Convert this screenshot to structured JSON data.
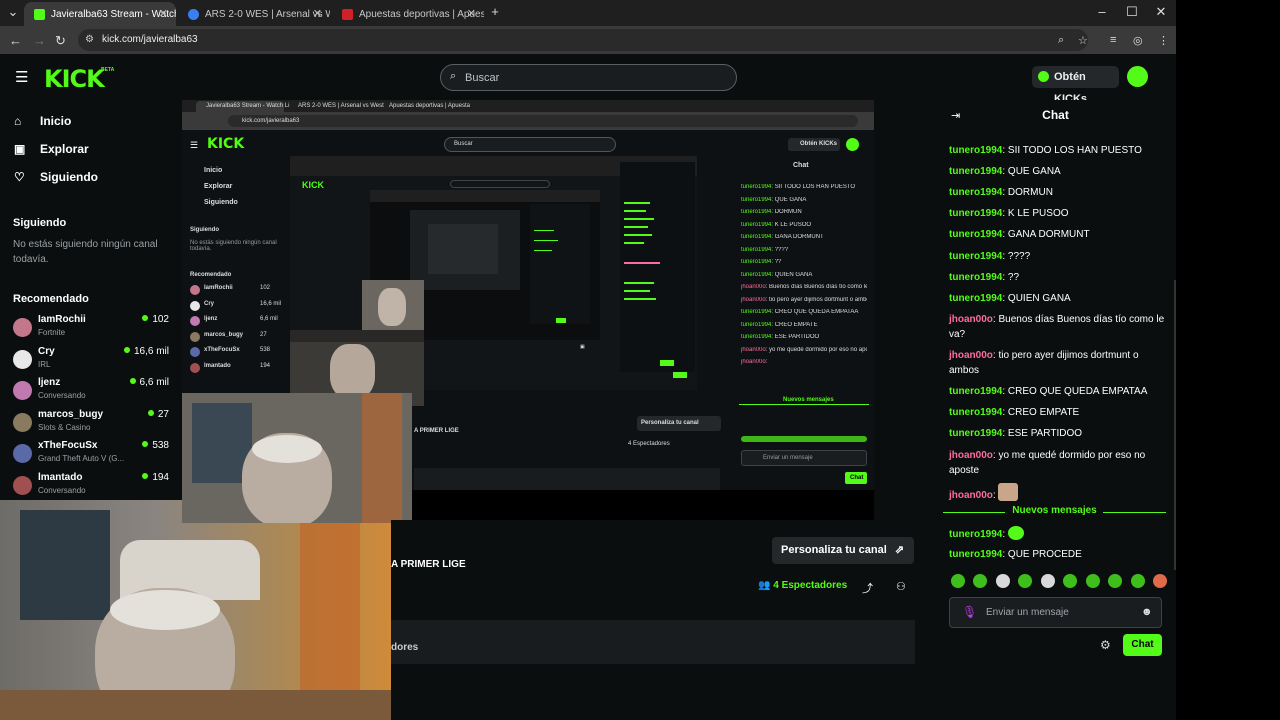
{
  "browser": {
    "tabs": [
      {
        "title": "Javieralba63 Stream - Watch Li",
        "active": true
      },
      {
        "title": "ARS 2-0 WES | Arsenal vs West",
        "active": false
      },
      {
        "title": "Apuestas deportivas | Apuesta",
        "active": false
      }
    ],
    "url": "kick.com/javieralba63"
  },
  "header": {
    "logo": "KICK",
    "beta": "BETA",
    "search_placeholder": "Buscar",
    "kicks_button": "Obtén KICKs"
  },
  "sidebar": {
    "nav": [
      {
        "label": "Inicio",
        "icon": "home-icon"
      },
      {
        "label": "Explorar",
        "icon": "compass-icon"
      },
      {
        "label": "Siguiendo",
        "icon": "heart-icon"
      }
    ],
    "following_title": "Siguiendo",
    "following_empty": "No estás siguiendo ningún canal todavía.",
    "recommended_title": "Recomendado",
    "recommended": [
      {
        "name": "IamRochii",
        "category": "Fortnite",
        "viewers": "102",
        "color": "#c2788a"
      },
      {
        "name": "Cry",
        "category": "IRL",
        "viewers": "16,6 mil",
        "color": "#e8e8e8"
      },
      {
        "name": "ljenz",
        "category": "Conversando",
        "viewers": "6,6 mil",
        "color": "#c07ab0"
      },
      {
        "name": "marcos_bugy",
        "category": "Slots & Casino",
        "viewers": "27",
        "color": "#8a7a60"
      },
      {
        "name": "xTheFocuSx",
        "category": "Grand Theft Auto V (G...",
        "viewers": "538",
        "color": "#5a6aa8"
      },
      {
        "name": "lmantado",
        "category": "Conversando",
        "viewers": "194",
        "color": "#a05050"
      }
    ]
  },
  "stream": {
    "nested_tabs": [
      "Javieralba63 Stream - Watch Li",
      "ARS 2-0 WES | Arsenal vs West",
      "Apuestas deportivas | Apuesta"
    ],
    "nested_url": "kick.com/javieralba63",
    "nested_search": "Buscar",
    "nested_kicks": "Obtén KICKs",
    "nested_nav": [
      "Inicio",
      "Explorar",
      "Siguiendo"
    ],
    "nested_following": "Siguiendo",
    "nested_following_empty": "No estás siguiendo ningún canal todavía.",
    "nested_recommended": "Recomendado",
    "nested_rec_names": [
      "IamRochii",
      "Cry",
      "ljenz",
      "marcos_bugy",
      "xTheFocuSx",
      "lmantado"
    ],
    "nested_rec_views": [
      "102",
      "16,6 mil",
      "6,6 mil",
      "27",
      "538",
      "194"
    ],
    "nested_chat_title": "Chat",
    "nested_personaliza": "Personaliza tu canal",
    "nested_primer": "A PRIMER LIGE",
    "nested_espect": "4 Espectadores",
    "nested_input": "Enviar un mensaje",
    "nested_chat_btn": "Chat",
    "nested_new": "Nuevos mensajes"
  },
  "channel": {
    "personaliza": "Personaliza tu canal",
    "title_fragment": "A PRIMER LIGE",
    "viewers_count": "4",
    "viewers_label": "Espectadores",
    "info_fragment": "dores"
  },
  "chat": {
    "title": "Chat",
    "messages": [
      {
        "user": "tunero1994",
        "text": "SII TODO LOS HAN PUESTO",
        "type": 1
      },
      {
        "user": "tunero1994",
        "text": "QUE GANA",
        "type": 1
      },
      {
        "user": "tunero1994",
        "text": "DORMUN",
        "type": 1
      },
      {
        "user": "tunero1994",
        "text": "K LE PUSOO",
        "type": 1
      },
      {
        "user": "tunero1994",
        "text": "GANA DORMUNT",
        "type": 1
      },
      {
        "user": "tunero1994",
        "text": "????",
        "type": 1
      },
      {
        "user": "tunero1994",
        "text": "??",
        "type": 1
      },
      {
        "user": "tunero1994",
        "text": "QUIEN GANA",
        "type": 1
      },
      {
        "user": "jhoan00o",
        "text": "Buenos días Buenos días tío como le va?",
        "type": 2
      },
      {
        "user": "jhoan00o",
        "text": "tio pero ayer dijimos dortmunt o ambos",
        "type": 2
      },
      {
        "user": "tunero1994",
        "text": "CREO QUE QUEDA EMPATAA",
        "type": 1
      },
      {
        "user": "tunero1994",
        "text": "CREO EMPATE",
        "type": 1
      },
      {
        "user": "tunero1994",
        "text": "ESE PARTIDOO",
        "type": 1
      },
      {
        "user": "jhoan00o",
        "text": "yo me quedé dormido por eso no aposte",
        "type": 2
      },
      {
        "user": "jhoan00o",
        "text": "",
        "type": 2
      }
    ],
    "new_messages": "Nuevos mensajes",
    "after": [
      {
        "user": "tunero1994",
        "text": "",
        "type": 1
      },
      {
        "user": "tunero1994",
        "text": "QUE PROCEDE",
        "type": 1
      }
    ],
    "input_placeholder": "Enviar un mensaje",
    "send_label": "Chat"
  },
  "colors": {
    "accent": "#53fc18",
    "user_pink": "#ff6b9a"
  }
}
